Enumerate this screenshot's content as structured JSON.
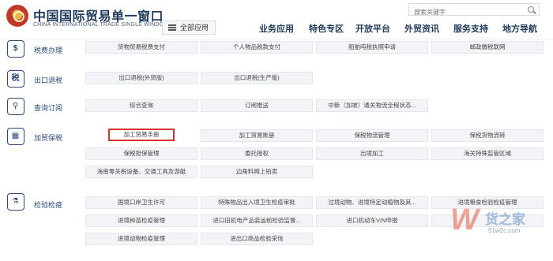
{
  "header": {
    "brand_cn": "中国国际贸易单一窗口",
    "brand_en": "CHINA INTERNATIONAL TRADE SINGLE WINDOW",
    "all_apps": "全部应用",
    "search_placeholder": "搜索关键字",
    "nav": [
      "业务应用",
      "特色专区",
      "开放平台",
      "外贸资讯",
      "服务支持",
      "地方导航"
    ]
  },
  "sections": {
    "tax": {
      "label": "税费办理",
      "items": [
        "货物贸易税费支付",
        "个人物品税款支付",
        "船舶吨税执照申请",
        "邮政缴税联网"
      ]
    },
    "export_refund": {
      "label": "出口退税",
      "icon_text": "税",
      "items": [
        "出口退税(外贸版)",
        "出口退税(生产版)"
      ]
    },
    "query": {
      "label": "查询订阅",
      "items": [
        "综合查询",
        "订阅推送",
        "中新（加坡）通关物流全程状态..."
      ]
    },
    "bonded": {
      "label": "加贸保税",
      "row1": [
        "加工贸易手册",
        "加工贸易账册",
        "保税物流管理",
        "保税货物流转"
      ],
      "row2": [
        "保税担保管理",
        "委托授权",
        "出境加工",
        "海关特殊监管区域"
      ],
      "row3": [
        "海南零关税设备、交通工具及游艇",
        "边角料网上拍卖"
      ]
    },
    "inspection": {
      "label": "检验检疫",
      "row1": [
        "国境口岸卫生许可",
        "特殊物品出入境卫生检疫审批",
        "过境动物、进境特定动植物及其...",
        "进境粮食检验检疫管理"
      ],
      "row2": [
        "进境种苗检疫管理",
        "进口旧机电产品装运前检验监督...",
        "进口机动车VIN申报",
        ""
      ],
      "row3": [
        "进境动物检疫管理",
        "进出口商品检验采信"
      ]
    }
  },
  "watermark": {
    "letter": "W",
    "cn": "货之家",
    "url": "51w2c.com"
  }
}
